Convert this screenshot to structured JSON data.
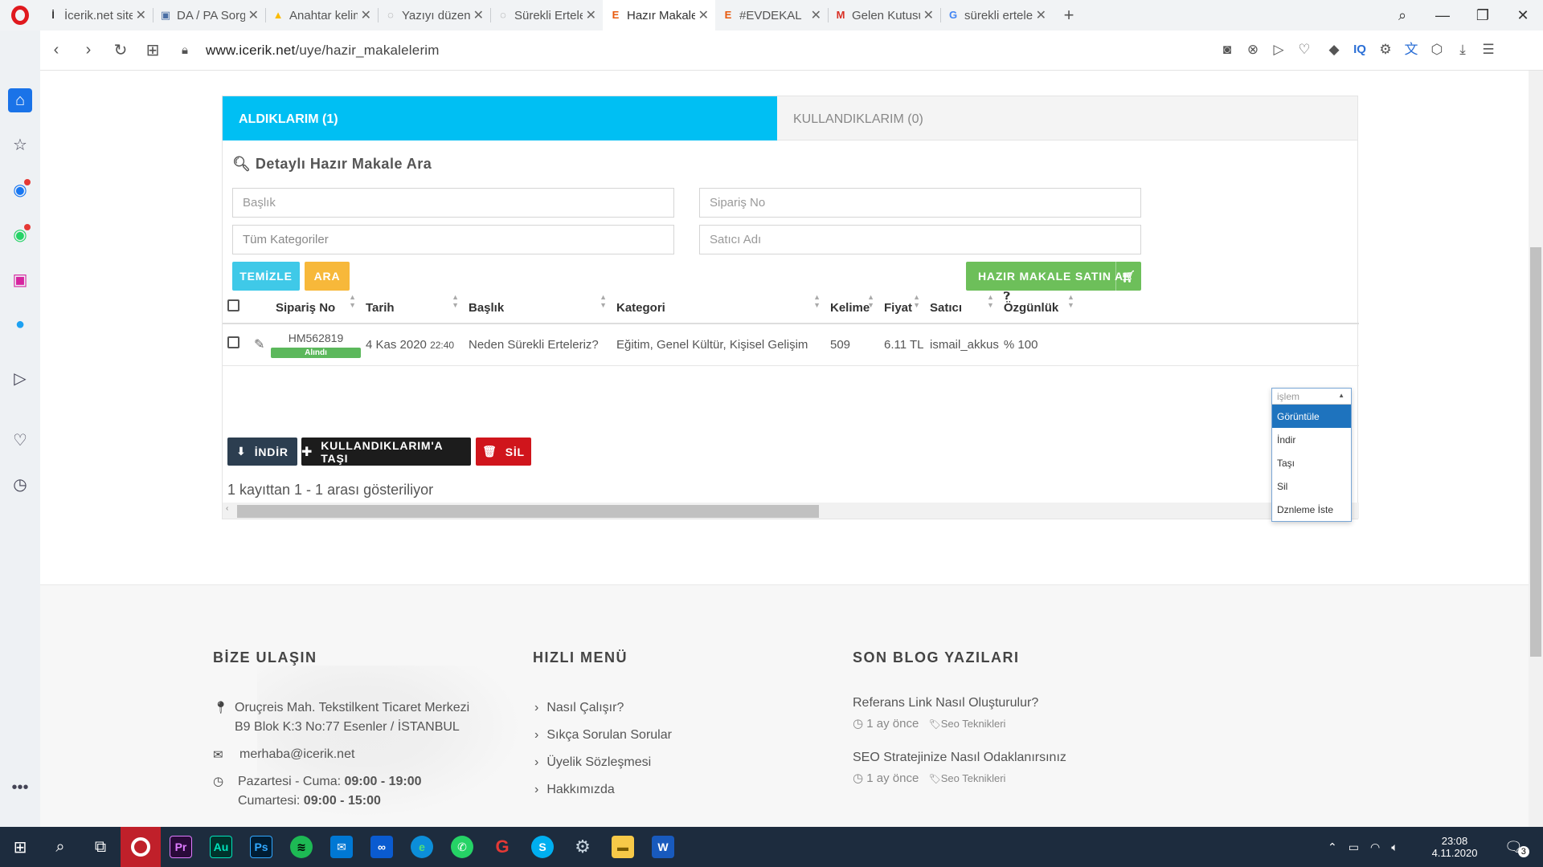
{
  "browser": {
    "tabs": [
      {
        "label": "İcerik.net sitesinde",
        "icon_color": "#333",
        "icon": "İ"
      },
      {
        "label": "DA / PA Sorgula",
        "icon_color": "#4a6fa5",
        "icon": "▣"
      },
      {
        "label": "Anahtar kelime f",
        "icon_color": "#fbbc04",
        "icon": "▲"
      },
      {
        "label": "Yazıyı düzenle ‹ İ",
        "icon_color": "#888",
        "icon": "◌"
      },
      {
        "label": "Sürekli Erteleme",
        "icon_color": "#888",
        "icon": "◌"
      },
      {
        "label": "Hazır Makaleleri",
        "icon_color": "#e8590c",
        "icon": "E",
        "active": true
      },
      {
        "label": "#EVDEKAL",
        "icon_color": "#e8590c",
        "icon": "E"
      },
      {
        "label": "Gelen Kutusu - e",
        "icon_color": "#d93025",
        "icon": "M"
      },
      {
        "label": "sürekli erteleme",
        "icon_color": "#4285f4",
        "icon": "G"
      }
    ],
    "url_host": "www.icerik.net",
    "url_path": "/uye/hazir_makalelerim"
  },
  "page": {
    "tab_active": "ALDIKLARIM (1)",
    "tab_inactive": "KULLANDIKLARIM (0)",
    "search_title": "Detaylı Hazır Makale Ara",
    "fields": {
      "baslik": "Başlık",
      "siparis_no": "Sipariş No",
      "kategori": "Tüm Kategoriler",
      "satici": "Satıcı Adı"
    },
    "btn_clear": "TEMİZLE",
    "btn_search": "ARA",
    "btn_buy": "HAZIR MAKALE SATIN AL",
    "columns": [
      "Sipariş No",
      "Tarih",
      "Başlık",
      "Kategori",
      "Kelime",
      "Fiyat",
      "Satıcı",
      "Özgünlük"
    ],
    "rows": [
      {
        "siparis_no": "HM562819",
        "status": "Alındı",
        "tarih": "4 Kas 2020",
        "saat": "22:40",
        "baslik": "Neden Sürekli Erteleriz?",
        "kategori": "Eğitim, Genel Kültür, Kişisel Gelişim",
        "kelime": "509",
        "fiyat": "6.11 TL",
        "satici": "ismail_akkus",
        "ozgunluk": "% 100"
      }
    ],
    "btn_indir": "İNDİR",
    "btn_tasi": "KULLANDIKLARIM'A TAŞI",
    "btn_sil": "SİL",
    "status_text": "1 kayıttan 1 - 1 arası gösteriliyor",
    "dropdown": {
      "placeholder": "işlem",
      "options": [
        "Görüntüle",
        "İndir",
        "Taşı",
        "Sil",
        "Dznleme İste"
      ],
      "selected_index": 0
    }
  },
  "footer": {
    "contact_title": "BİZE ULAŞIN",
    "address_line1": "Oruçreis Mah. Tekstilkent Ticaret Merkezi",
    "address_line2": "B9 Blok K:3 No:77 Esenler / İSTANBUL",
    "email": "merhaba@icerik.net",
    "hours1_label": "Pazartesi - Cuma: ",
    "hours1_value": "09:00 - 19:00",
    "hours2_label": "Cumartesi: ",
    "hours2_value": "09:00 - 15:00",
    "menu_title": "HIZLI MENÜ",
    "menu_items": [
      "Nasıl Çalışır?",
      "Sıkça Sorulan Sorular",
      "Üyelik Sözleşmesi",
      "Hakkımızda"
    ],
    "blog_title": "SON BLOG YAZILARI",
    "blog_posts": [
      {
        "title": "Referans Link Nasıl Oluşturulur?",
        "time": "1 ay önce",
        "tag": "Seo Teknikleri"
      },
      {
        "title": "SEO Stratejinize Nasıl Odaklanırsınız",
        "time": "1 ay önce",
        "tag": "Seo Teknikleri"
      }
    ]
  },
  "taskbar": {
    "time": "23:08",
    "date": "4.11.2020",
    "notifications": "3"
  },
  "colors": {
    "accent_cyan": "#00bff3",
    "clear_btn": "#3fc9e8",
    "search_btn": "#f7b83a",
    "buy_btn": "#6dbf5a",
    "indir_btn": "#2c3e50",
    "tasi_btn": "#1c1c1c",
    "sil_btn": "#d0151c"
  }
}
